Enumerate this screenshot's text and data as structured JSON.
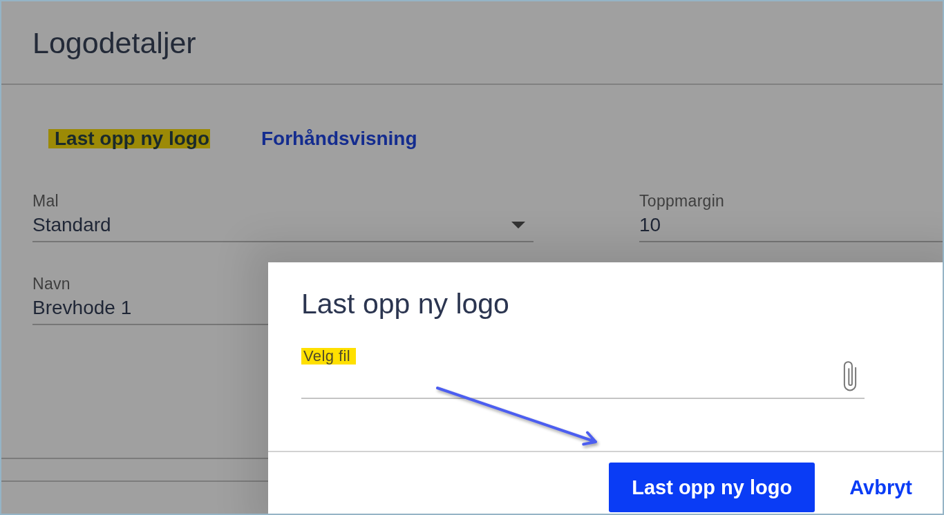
{
  "page": {
    "title": "Logodetaljer"
  },
  "actions": [
    {
      "label": "Last opp ny logo",
      "highlighted": true
    },
    {
      "label": "Forhåndsvisning",
      "highlighted": false
    }
  ],
  "form": {
    "fields": [
      {
        "kind": "select",
        "label": "Mal",
        "value": "Standard"
      },
      {
        "kind": "text",
        "label": "Toppmargin",
        "value": "10"
      },
      {
        "kind": "text",
        "label": "Navn",
        "value": "Brevhode 1"
      }
    ]
  },
  "dialog": {
    "title": "Last opp ny logo",
    "file_field": {
      "label": "Velg fil",
      "highlighted": true
    },
    "buttons": [
      {
        "kind": "primary",
        "label": "Last opp ny logo"
      },
      {
        "kind": "text",
        "label": "Avbryt"
      }
    ]
  }
}
